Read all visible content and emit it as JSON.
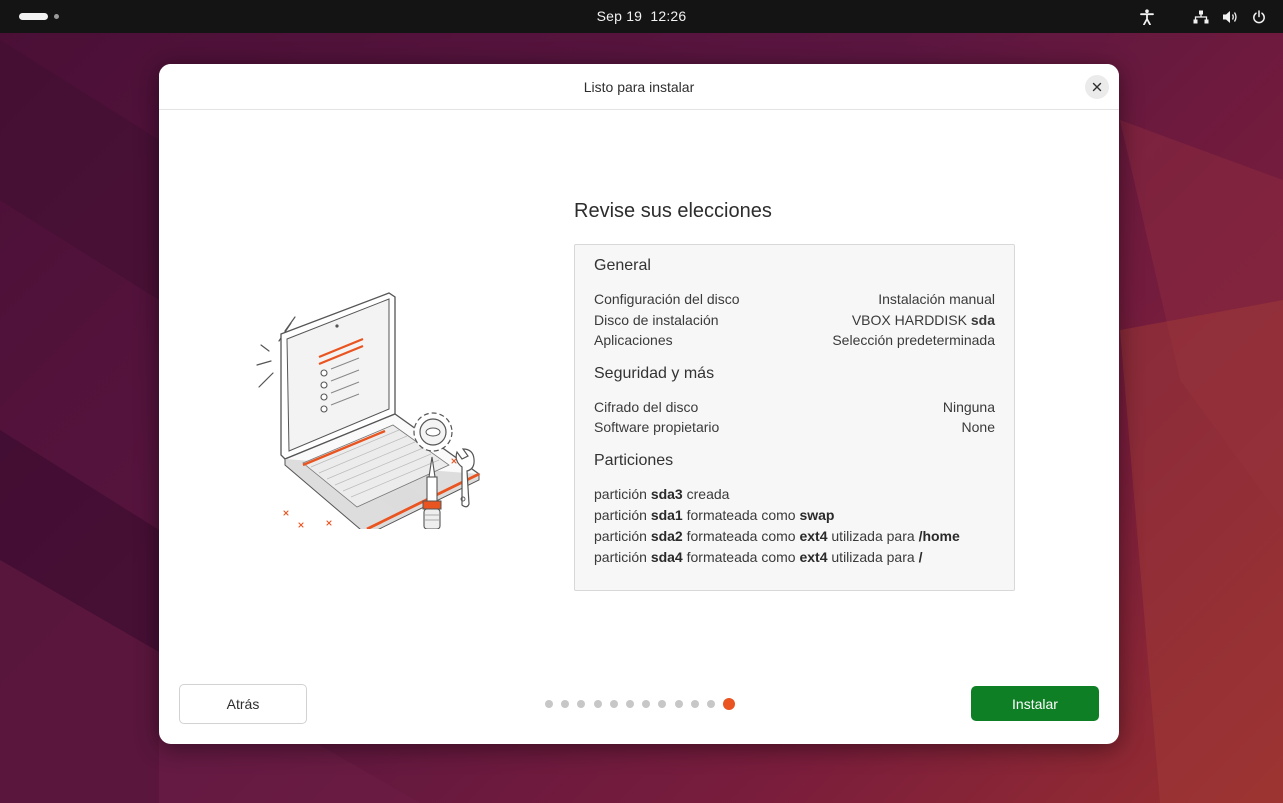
{
  "topbar": {
    "date": "Sep 19",
    "time": "12:26",
    "icons": [
      "accessibility-icon",
      "network-icon",
      "volume-icon",
      "power-icon"
    ]
  },
  "dialog": {
    "title": "Listo para instalar",
    "heading": "Revise sus elecciones",
    "general": {
      "title": "General",
      "rows": [
        {
          "label": "Configuración del disco",
          "value": "Instalación manual"
        },
        {
          "label": "Disco de instalación",
          "value_prefix": "VBOX HARDDISK",
          "value_bold": "sda"
        },
        {
          "label": "Aplicaciones",
          "value": "Selección predeterminada"
        }
      ]
    },
    "security": {
      "title": "Seguridad y más",
      "rows": [
        {
          "label": "Cifrado del disco",
          "value": "Ninguna"
        },
        {
          "label": "Software propietario",
          "value": "None"
        }
      ]
    },
    "partitions": {
      "title": "Particiones",
      "lines": [
        {
          "p1": "partición",
          "dev": "sda3",
          "p2": "creada"
        },
        {
          "p1": "partición",
          "dev": "sda1",
          "p2": "formateada como",
          "fs": "swap"
        },
        {
          "p1": "partición",
          "dev": "sda2",
          "p2": "formateada como",
          "fs": "ext4",
          "p3": "utilizada para",
          "mount": "/home"
        },
        {
          "p1": "partición",
          "dev": "sda4",
          "p2": "formateada como",
          "fs": "ext4",
          "p3": "utilizada para",
          "mount": "/"
        }
      ]
    },
    "back_label": "Atrás",
    "install_label": "Instalar",
    "steps_total": 12,
    "step_current": 12
  },
  "colors": {
    "accent": "#e95420",
    "install_button": "#0e7f24",
    "topbar": "#141414"
  }
}
